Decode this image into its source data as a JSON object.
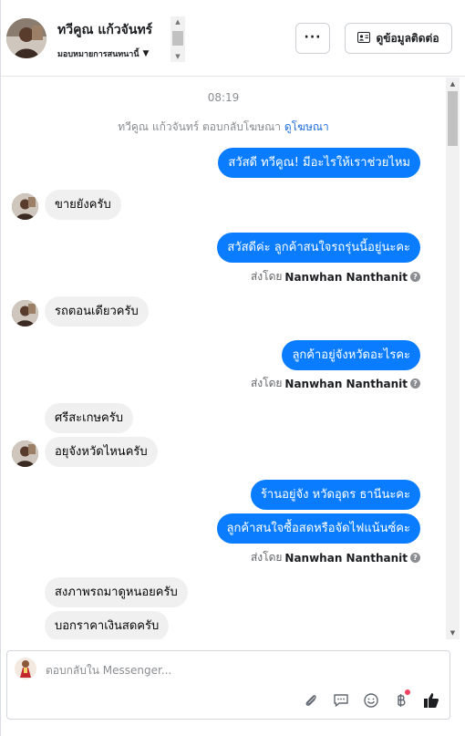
{
  "header": {
    "name": "ทวีคูณ แก้วจันทร์",
    "assign_label": "มอบหมายการสนทนานี้",
    "more_label": "···",
    "contact_label": "ดูข้อมูลติดต่อ"
  },
  "chat": {
    "time": "08:19",
    "notice_prefix": "ทวีคูณ แก้วจันทร์ ตอบกลับโฆษณา",
    "notice_link": "ดูโฆษณา",
    "messages": [
      {
        "text": "สวัสดี ทวีคูณ! มีอะไรให้เราช่วยไหม"
      },
      {
        "text": "ขายยังครับ"
      },
      {
        "text": "สวัสดีค่ะ ลูกค้าสนใจรถรุ่นนี้อยู่นะคะ"
      },
      {
        "text": "รถตอนเดียวครับ"
      },
      {
        "text": "ลูกค้าอยู่จังหวัดอะไรคะ"
      },
      {
        "text": "ศรีสะเกษครับ"
      },
      {
        "text": "อยุจังหวัดไหนครับ"
      },
      {
        "text": "ร้านอยู่จัง หวัดอุดร ธานีนะคะ"
      },
      {
        "text": "ลูกค้าสนใจซื้อสดหรือจัดไฟแน้นซ์คะ"
      },
      {
        "text": "สงภาพรถมาดูหนอยครับ"
      },
      {
        "text": "บอกราคาเงินสดครับ"
      }
    ],
    "sent_by_prefix": "ส่งโดย",
    "sent_by_name": "Nanwhan Nanthanit"
  },
  "composer": {
    "placeholder": "ตอบกลับใน Messenger..."
  },
  "icons": {
    "more": "more-dots-icon",
    "contact": "contact-card-icon",
    "attach": "paperclip-icon",
    "saved_reply": "chat-bubble-icon",
    "emoji": "smiley-icon",
    "payment": "baht-icon",
    "like": "thumbs-up-icon"
  },
  "colors": {
    "outgoing": "#0a7cff",
    "incoming": "#f0f0f0",
    "link": "#216fdb"
  }
}
